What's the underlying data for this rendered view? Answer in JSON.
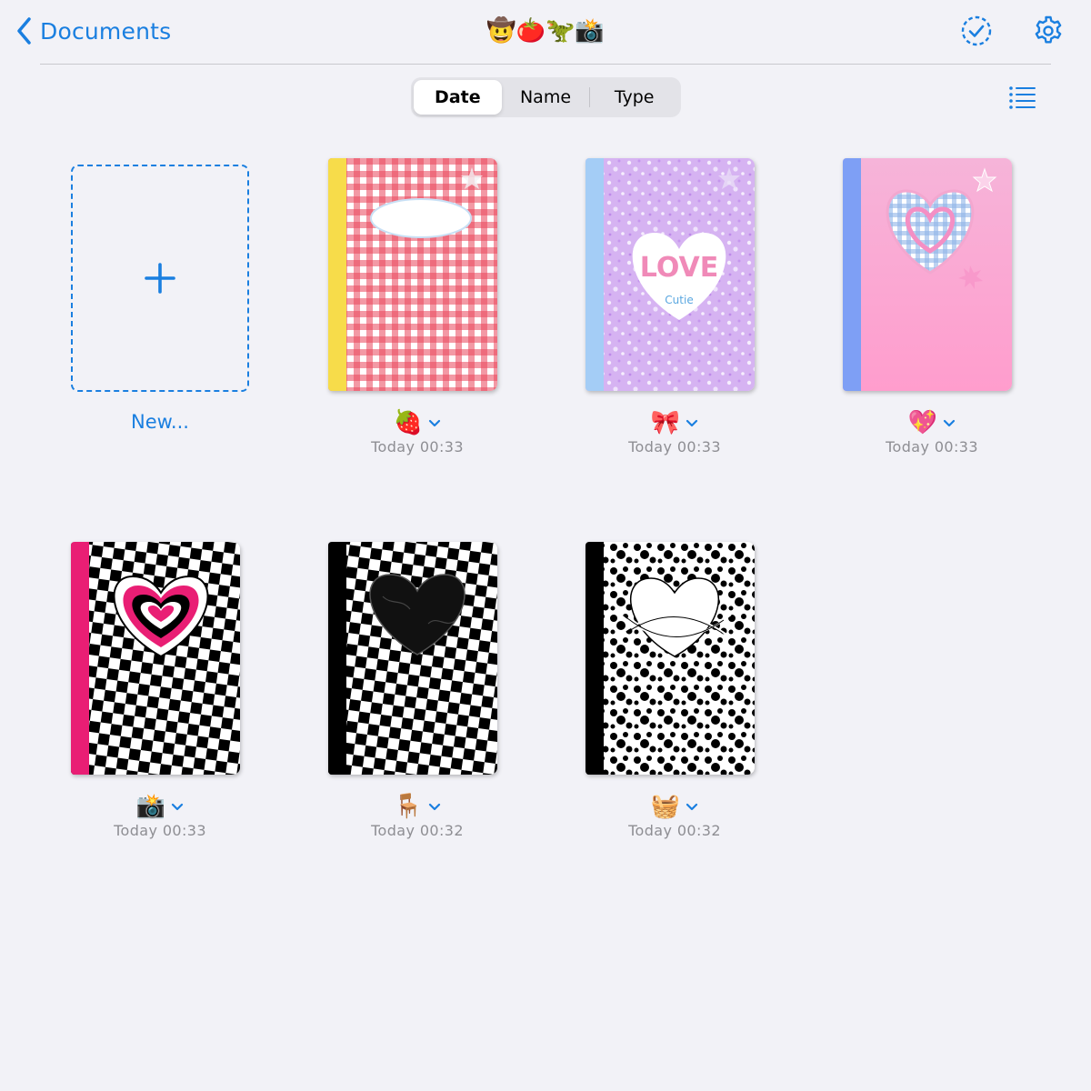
{
  "header": {
    "back_label": "Documents",
    "title": "🤠🍅🦖📸",
    "accent_color": "#1a7fe0"
  },
  "sort": {
    "options": [
      "Date",
      "Name",
      "Type"
    ],
    "selected": "Date"
  },
  "new_document": {
    "label": "New..."
  },
  "documents": [
    {
      "emoji": "🍓",
      "date": "Today 00:33",
      "cover": "red-gingham",
      "spine_color": "#f7dc4a"
    },
    {
      "emoji": "🎀",
      "date": "Today 00:33",
      "cover": "lavender-love",
      "spine_color": "#a4cdf6",
      "cover_text": "LOVE",
      "cover_subtext": "Cutie"
    },
    {
      "emoji": "💖",
      "date": "Today 00:33",
      "cover": "pink-gingham-heart",
      "spine_color": "#7e9ff5"
    },
    {
      "emoji": "📸",
      "date": "Today 00:33",
      "cover": "checker-pink-heart",
      "spine_color": "#e91e74"
    },
    {
      "emoji": "🪑",
      "date": "Today 00:32",
      "cover": "checker-black-heart",
      "spine_color": "#000000"
    },
    {
      "emoji": "🧺",
      "date": "Today 00:32",
      "cover": "marble-white-heart",
      "spine_color": "#000000"
    }
  ]
}
